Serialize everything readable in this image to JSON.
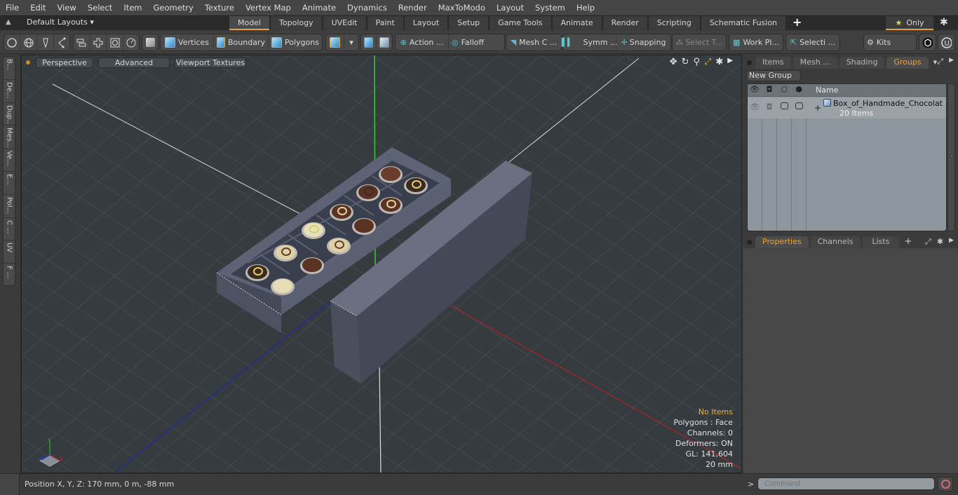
{
  "menu": [
    "File",
    "Edit",
    "View",
    "Select",
    "Item",
    "Geometry",
    "Texture",
    "Vertex Map",
    "Animate",
    "Dynamics",
    "Render",
    "MaxToModo",
    "Layout",
    "System",
    "Help"
  ],
  "layout_bar": {
    "layouts_label": "Default Layouts",
    "tabs": [
      "Model",
      "Topology",
      "UVEdit",
      "Paint",
      "Layout",
      "Setup",
      "Game Tools",
      "Animate",
      "Render",
      "Scripting",
      "Schematic Fusion"
    ],
    "active_tab": "Model",
    "only_label": "Only"
  },
  "toolbar": {
    "modes": [
      "Vertices",
      "Boundary",
      "Polygons"
    ],
    "action": "Action ...",
    "falloff": "Falloff",
    "mesh": "Mesh C ...",
    "symm": "Symm ...",
    "snapping": "Snapping",
    "select_t": "Select T...",
    "workplane": "Work Pl...",
    "selection": "Selecti ...",
    "kits": "Kits"
  },
  "left_strip": [
    "B...",
    "De...",
    "Dup...",
    "Mes...",
    "Ve...",
    "E...",
    "Pol...",
    "C ...",
    "UV",
    "F ..."
  ],
  "viewport": {
    "buttons": [
      "Perspective",
      "Advanced",
      "Viewport Textures"
    ],
    "hud": {
      "selection": "No Items",
      "polygons": "Polygons : Face",
      "channels": "Channels: 0",
      "deformers": "Deformers: ON",
      "gl": "GL: 141,604",
      "scale": "20 mm"
    },
    "axis_labels": {
      "x": "X",
      "y": "Y",
      "z": "Z"
    },
    "colors": {
      "background": "#353b3f",
      "box": "#4f5464",
      "y_axis": "#2fd02f",
      "x_axis": "#b02222",
      "z_axis": "#1c2aa8"
    }
  },
  "right_panel": {
    "top_tabs": [
      "Items",
      "Mesh ...",
      "Shading",
      "Groups"
    ],
    "active_top_tab": "Groups",
    "new_group_label": "New Group",
    "table_header": "Name",
    "groups": [
      {
        "name": "Box_of_Handmade_Chocolat ...",
        "count": "20 Items"
      }
    ],
    "bottom_tabs": [
      "Properties",
      "Channels",
      "Lists"
    ],
    "active_bottom_tab": "Properties"
  },
  "status": {
    "position": "Position X, Y, Z:   170 mm, 0 m, -88 mm",
    "prompt": ">",
    "command_placeholder": "Command"
  },
  "accent_color": "#e8a33d"
}
